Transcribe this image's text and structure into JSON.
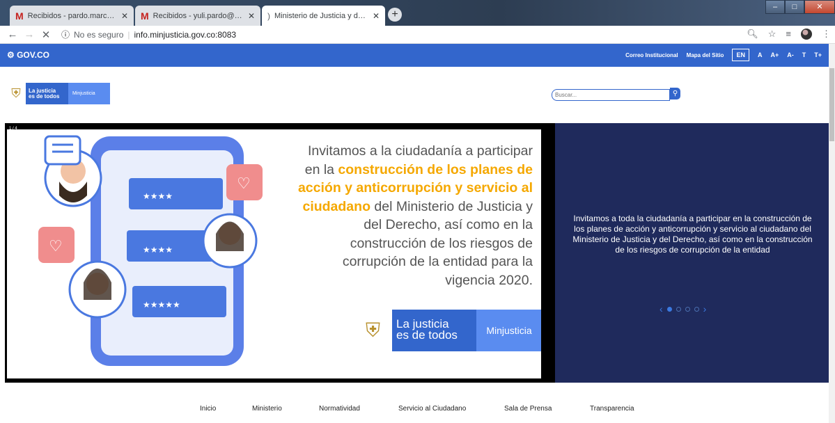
{
  "browser": {
    "tabs": [
      {
        "label": "Recibidos - pardo.marcela@gmail.com",
        "icon": "gmail-icon"
      },
      {
        "label": "Recibidos - yuli.pardo@minjusticia.gov.co",
        "icon": "gmail-icon"
      },
      {
        "label": "Ministerio de Justicia y del Derecho",
        "icon": "loading-icon"
      }
    ],
    "security": "No es seguro",
    "url": "info.minjusticia.gov.co:8083"
  },
  "govbar": {
    "logo": "GOV.CO",
    "links": [
      "Correo Institucional",
      "Mapa del Sitio"
    ],
    "lang": "EN",
    "sizes": [
      "A",
      "A+",
      "A-",
      "T",
      "T+"
    ]
  },
  "header": {
    "logo_line1": "La justicia",
    "logo_line2": "es de todos",
    "logo_brand": "Minjusticia",
    "search_placeholder": "Buscar..."
  },
  "carousel": {
    "counter": "1 / 4",
    "caption": "Invitamos a toda la ciudadanía a participar en la construcción de los planes de acción y anticorrupción y servicio al ciudadano del Ministerio de Justicia y del Derecho, así como en la construcción de los riesgos de corrupción de la entidad",
    "slide_text_1": "Invitamos a la ciudadanía a participar en la ",
    "slide_highlight": "construcción de los planes de acción y anticorrupción y servicio al ciudadano",
    "slide_text_2": " del Ministerio de Justicia y del Derecho, así como en la construcción de los riesgos de corrupción de la entidad para la vigencia 2020.",
    "slide_logo_line1": "La justicia",
    "slide_logo_line2": "es de todos",
    "slide_logo_brand": "Minjusticia"
  },
  "mainnav": [
    "Inicio",
    "Ministerio",
    "Normatividad",
    "Servicio al Ciudadano",
    "Sala de Prensa",
    "Transparencia"
  ]
}
